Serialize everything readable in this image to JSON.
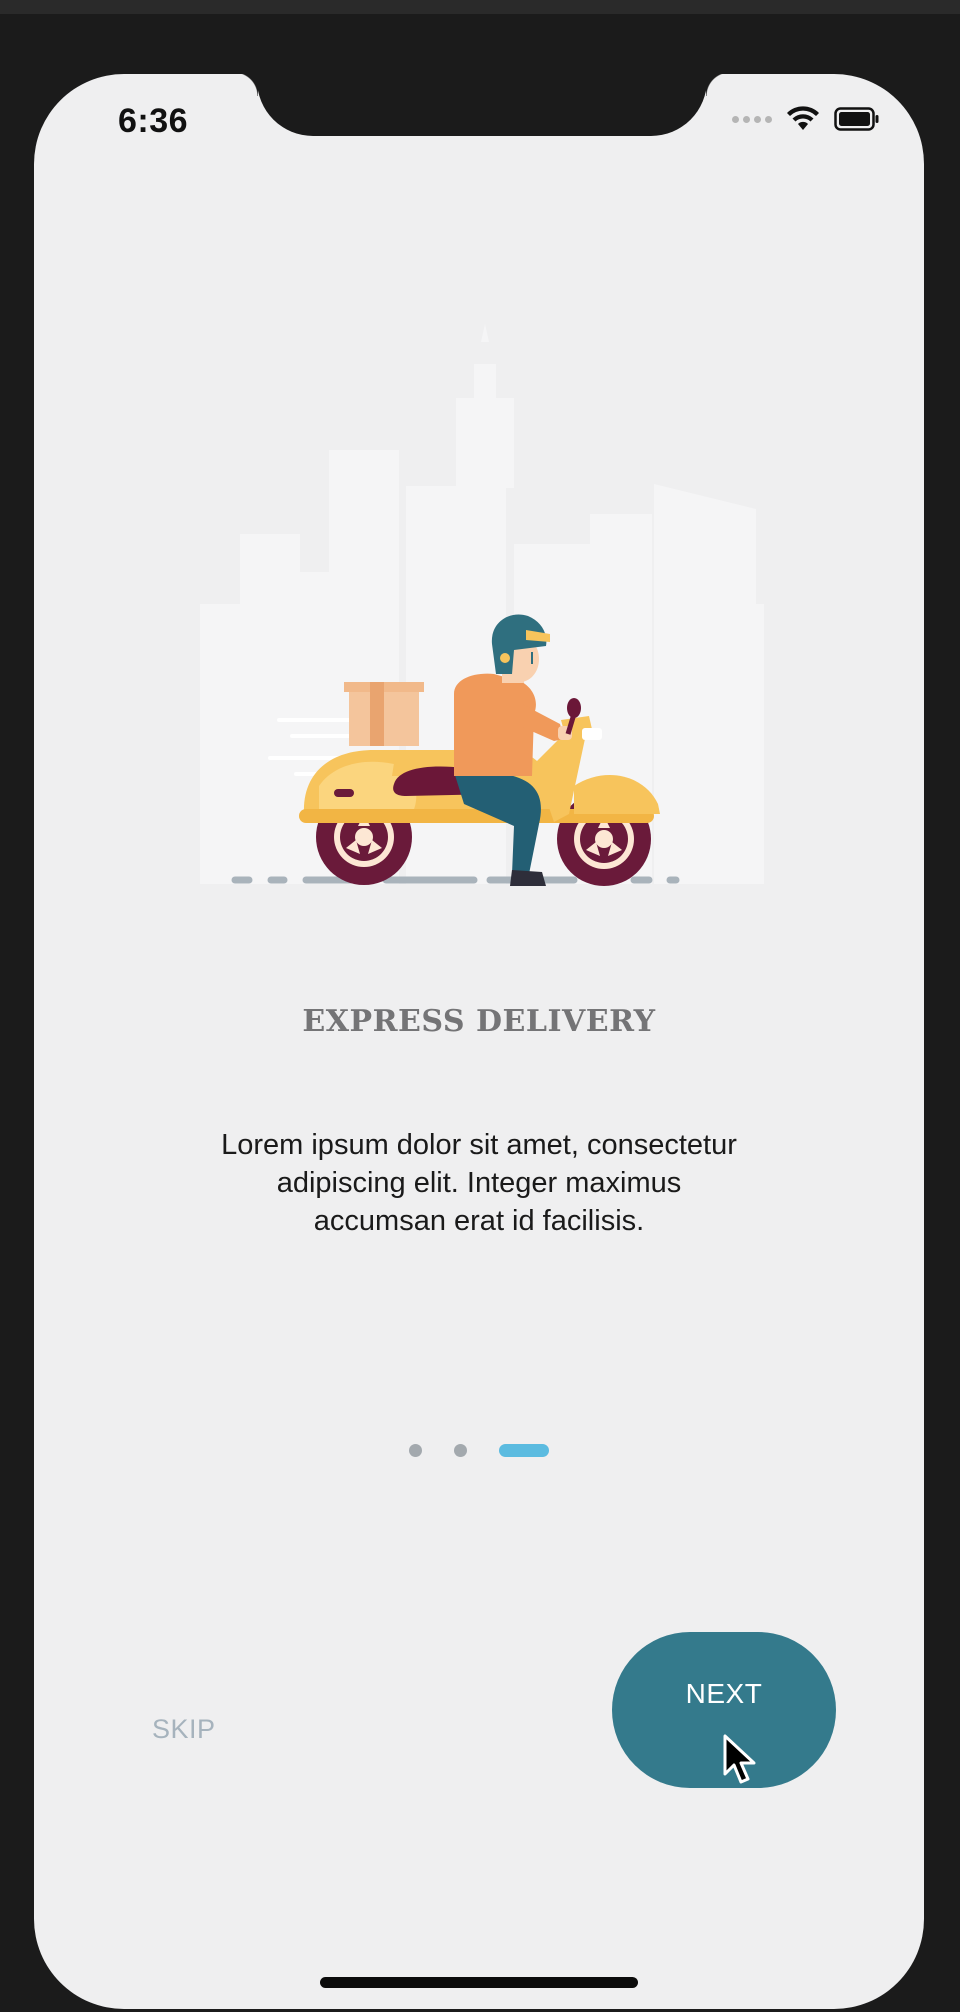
{
  "status_bar": {
    "time": "6:36",
    "icons": [
      "cellular-signal-icon",
      "wifi-icon",
      "battery-icon"
    ]
  },
  "onboarding": {
    "illustration": "delivery-scooter-illustration",
    "title": "EXPRESS DELIVERY",
    "description": "Lorem ipsum dolor sit amet, consectetur adipiscing elit. Integer maximus accumsan erat id facilisis.",
    "page_count": 3,
    "current_page": 3
  },
  "actions": {
    "skip_label": "SKIP",
    "next_label": "NEXT"
  },
  "colors": {
    "screen_background": "#efeff0",
    "title": "#747476",
    "next_button": "#347a8c",
    "active_dot": "#5bbbe0",
    "inactive_dot": "#a3a9ae",
    "skip_text": "#a6b3bd",
    "scooter_body": "#f7c45c",
    "scooter_seat": "#6b1738",
    "rider_shirt": "#f0995a",
    "rider_helmet": "#2f6f7f"
  }
}
